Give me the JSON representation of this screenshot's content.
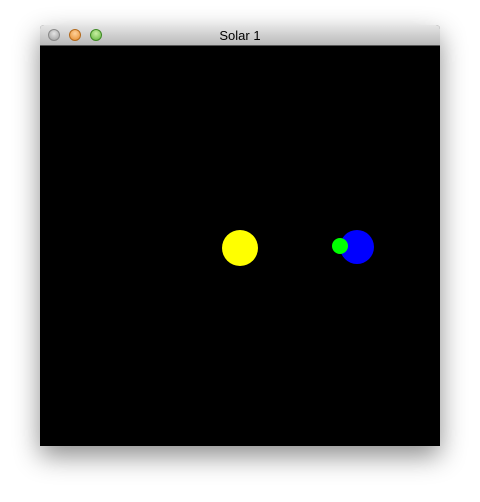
{
  "window": {
    "title": "Solar 1"
  },
  "scene": {
    "background_color": "#000000",
    "bodies": [
      {
        "name": "sun",
        "color": "#ffff00"
      },
      {
        "name": "planet",
        "color": "#0000ff"
      },
      {
        "name": "moon",
        "color": "#00ff00"
      }
    ]
  }
}
